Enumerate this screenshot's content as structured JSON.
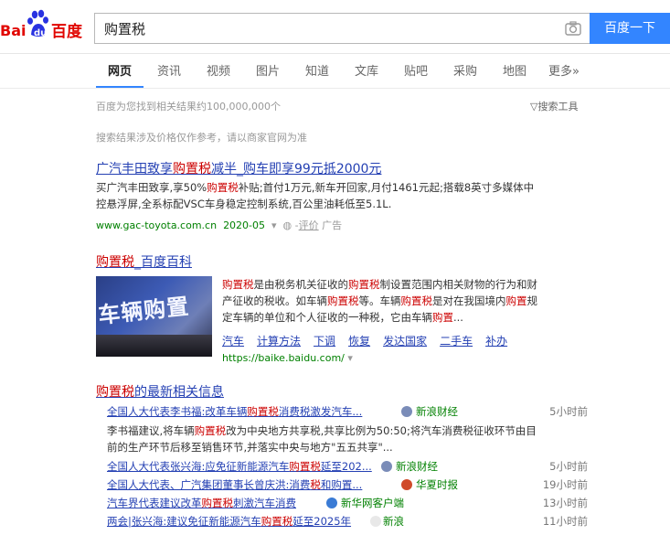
{
  "search": {
    "query": "购置税",
    "button_label": "百度一下"
  },
  "tabs": [
    "网页",
    "资讯",
    "视频",
    "图片",
    "知道",
    "文库",
    "贴吧",
    "采购",
    "地图",
    "更多»"
  ],
  "result_count": "百度为您找到相关结果约100,000,000个",
  "search_tools": "搜索工具",
  "notice": "搜索结果涉及价格仅作参考，请以商家官网为准",
  "ad": {
    "title_pre": "广汽丰田致享",
    "title_kw": "购置税",
    "title_post": "减半_购车即享99元抵2000元",
    "abs_l1_pre": "买广汽丰田致享,享50%",
    "abs_l1_kw": "购置税",
    "abs_l1_post": "补贴;首付1万元,新车开回家,月付1461元起;搭载8英寸多媒体中",
    "abs_l2": "控悬浮屏,全系标配VSC车身稳定控制系统,百公里油耗低至5.1L.",
    "url": "www.gac-toyota.com.cn",
    "date": "2020-05",
    "eval": "评价",
    "ad_label": "广告"
  },
  "baike": {
    "title_kw": "购置税",
    "title_post": "_百度百科",
    "thumb_text": "车辆购置",
    "l1_kw1": "购置税",
    "l1_a": "是由税务机关征收的",
    "l1_kw2": "购置税",
    "l1_b": "制设置范围内相关财物的行为和财",
    "l2_a": "产征收的税收。如车辆",
    "l2_kw": "购置税",
    "l2_b": "等。车辆",
    "l2_kw2": "购置税",
    "l2_c": "是对在我国境内",
    "l2_kw3": "购置",
    "l2_d": "规",
    "l3_a": "定车辆的单位和个人征收的一种税，它由车辆",
    "l3_kw": "购置",
    "l3_b": "...",
    "links": [
      "汽车",
      "计算方法",
      "下调",
      "恢复",
      "发达国家",
      "二手车",
      "补办"
    ],
    "url": "https://baike.baidu.com/"
  },
  "news": {
    "title_kw": "购置税",
    "title_post": "的最新相关信息",
    "items": [
      {
        "pre": "全国人大代表李书福:改革车辆",
        "kw": "购置税",
        "post": "消费税激发汽车...",
        "source": "新浪财经",
        "time": "5小时前"
      },
      {
        "pre": "全国人大代表张兴海:应免征新能源汽车",
        "kw": "购置税",
        "post": "延至202...",
        "source": "新浪财经",
        "time": "5小时前"
      },
      {
        "pre": "全国人大代表、广汽集团董事长曾庆洪:消费",
        "kw": "税",
        "post": "和购置...",
        "source": "华夏时报",
        "time": "19小时前"
      },
      {
        "pre": "汽车界代表建议改革",
        "kw": "购置税",
        "post": "刺激汽车消费",
        "source": "新华网客户端",
        "time": "13小时前"
      },
      {
        "pre": "两会|张兴海:建议免征新能源汽车",
        "kw": "购置税",
        "post": "延至2025年",
        "source": "新浪",
        "time": "11小时前"
      }
    ],
    "abs_l1_a": "李书福建议,将车辆",
    "abs_l1_kw": "购置税",
    "abs_l1_b": "改为中央地方共享税,共享比例为50:50;将汽车消费税征收环节由目",
    "abs_l2": "前的生产环节后移至销售环节,并落实中央与地方\"五五共享\"..."
  }
}
